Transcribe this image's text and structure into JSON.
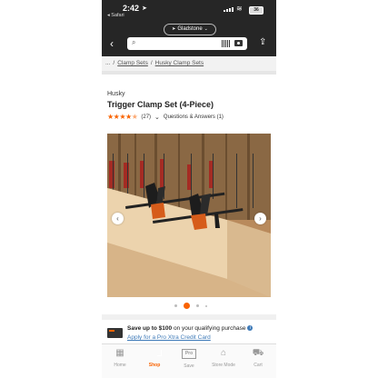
{
  "status_bar": {
    "time": "2:42",
    "back_app": "◂ Safari",
    "battery": "36"
  },
  "header": {
    "store_name": "Gladstone",
    "search_placeholder": ""
  },
  "breadcrumb": {
    "ellipsis": "...",
    "items": [
      "Clamp Sets",
      "Husky Clamp Sets"
    ]
  },
  "product": {
    "brand": "Husky",
    "title": "Trigger Clamp Set (4-Piece)",
    "rating": 4.5,
    "review_count": "(27)",
    "qa_label": "Questions & Answers (1)"
  },
  "gallery": {
    "image_count": 4,
    "active_index": 1
  },
  "promo": {
    "text_prefix": "Save up to $100",
    "text_suffix": " on your qualifying purchase",
    "link": "Apply for a Pro Xtra Credit Card"
  },
  "tab_bar": {
    "items": [
      {
        "label": "Home",
        "icon": "home-icon"
      },
      {
        "label": "Shop",
        "icon": "shop-icon"
      },
      {
        "label": "Save",
        "icon": "pro-xtra-icon"
      },
      {
        "label": "Store Mode",
        "icon": "store-icon"
      },
      {
        "label": "Cart",
        "icon": "cart-icon"
      }
    ],
    "pro_badge": "Pro",
    "active": "Shop"
  },
  "colors": {
    "brand_orange": "#f96302",
    "header_dark": "#262626",
    "link_blue": "#3e7ab8"
  }
}
